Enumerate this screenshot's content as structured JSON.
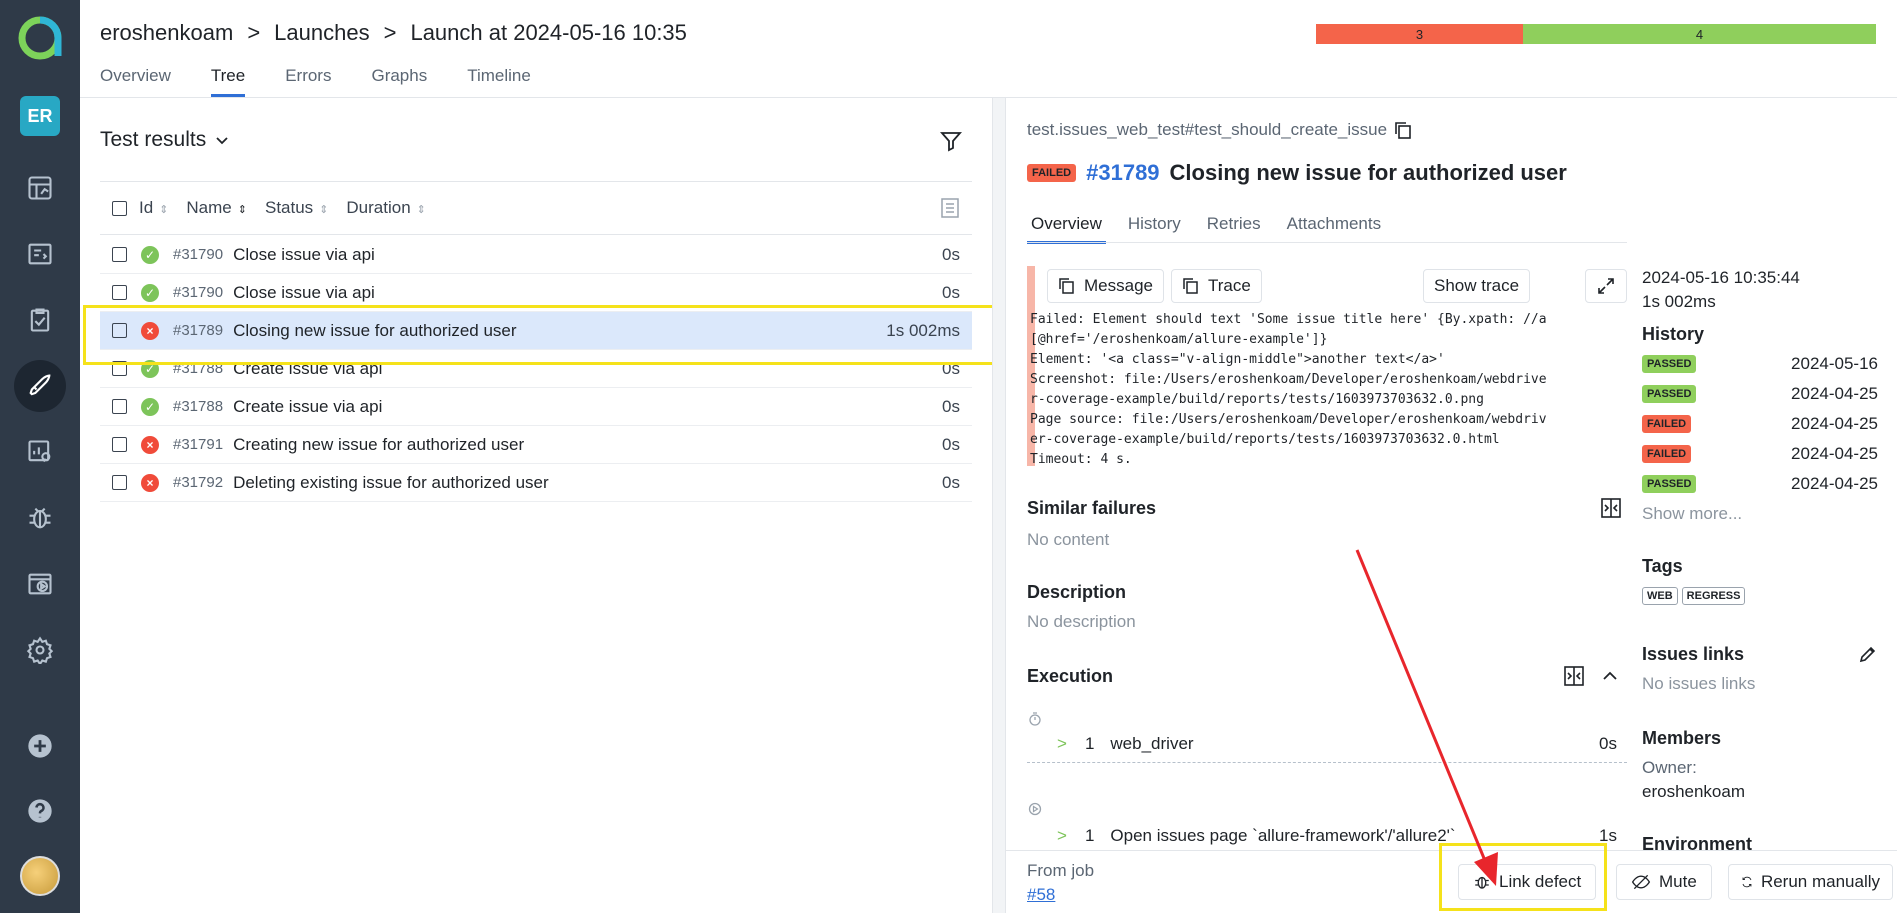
{
  "sidebar": {
    "avatar_initials": "ER",
    "items": [
      "dashboards-icon",
      "test-cases-icon",
      "test-plans-icon",
      "launches-icon",
      "analytics-icon",
      "defects-icon",
      "jobs-icon",
      "settings-icon"
    ]
  },
  "header": {
    "breadcrumb": [
      "eroshenkoam",
      "Launches",
      "Launch at 2024-05-16 10:35"
    ],
    "tabs": [
      "Overview",
      "Tree",
      "Errors",
      "Graphs",
      "Timeline"
    ],
    "active_tab": "Tree",
    "stats": {
      "failed": "3",
      "passed": "4"
    }
  },
  "colors": {
    "failed": "#f4644a",
    "passed": "#8fcf5c",
    "accent": "#2f6fd6",
    "sidebar": "#2f3a48"
  },
  "tree": {
    "title": "Test results",
    "columns": [
      "Id",
      "Name",
      "Status",
      "Duration"
    ],
    "rows": [
      {
        "id": "#31790",
        "name": "Close issue via api",
        "status": "passed",
        "duration": "0s"
      },
      {
        "id": "#31790",
        "name": "Close issue via api",
        "status": "passed",
        "duration": "0s"
      },
      {
        "id": "#31789",
        "name": "Closing new issue for authorized user",
        "status": "failed",
        "duration": "1s 002ms"
      },
      {
        "id": "#31788",
        "name": "Create issue via api",
        "status": "passed",
        "duration": "0s"
      },
      {
        "id": "#31788",
        "name": "Create issue via api",
        "status": "passed",
        "duration": "0s"
      },
      {
        "id": "#31791",
        "name": "Creating new issue for authorized user",
        "status": "failed",
        "duration": "0s"
      },
      {
        "id": "#31792",
        "name": "Deleting existing issue for authorized user",
        "status": "failed",
        "duration": "0s"
      }
    ]
  },
  "detail": {
    "path": "test.issues_web_test#test_should_create_issue",
    "status": "FAILED",
    "id": "#31789",
    "title": "Closing new issue for authorized user",
    "tabs": [
      "Overview",
      "History",
      "Retries",
      "Attachments"
    ],
    "message_btn": "Message",
    "trace_btn": "Trace",
    "show_trace_btn": "Show trace",
    "message_lines": [
      "Failed: Element should text 'Some issue title here' {By.xpath: //a",
      "[@href='/eroshenkoam/allure-example']}",
      "Element: '<a class=\"v-align-middle\">another text</a>'",
      "Screenshot: file:/Users/eroshenkoam/Developer/eroshenkoam/webdrive",
      "r-coverage-example/build/reports/tests/1603973703632.0.png",
      "Page source: file:/Users/eroshenkoam/Developer/eroshenkoam/webdriv",
      "er-coverage-example/build/reports/tests/1603973703632.0.html",
      "Timeout: 4 s."
    ],
    "similar_failures": "Similar failures",
    "similar_empty": "No content",
    "description": "Description",
    "description_empty": "No description",
    "execution": "Execution",
    "steps": [
      {
        "num": "1",
        "name": "web_driver",
        "duration": "0s"
      },
      {
        "num": "1",
        "name": "Open issues page `allure-framework'/'allure2'`",
        "duration": "1s"
      }
    ],
    "from_job": "From job",
    "job_link": "#58",
    "link_defect": "Link defect",
    "mute": "Mute",
    "rerun": "Rerun manually"
  },
  "meta": {
    "started": "2024-05-16 10:35:44",
    "duration": "1s 002ms",
    "history_title": "History",
    "history": [
      {
        "status": "PASSED",
        "date": "2024-05-16"
      },
      {
        "status": "PASSED",
        "date": "2024-04-25"
      },
      {
        "status": "FAILED",
        "date": "2024-04-25"
      },
      {
        "status": "FAILED",
        "date": "2024-04-25"
      },
      {
        "status": "PASSED",
        "date": "2024-04-25"
      }
    ],
    "show_more": "Show more...",
    "tags_title": "Tags",
    "tags": [
      "WEB",
      "REGRESS"
    ],
    "issues_title": "Issues links",
    "issues_empty": "No issues links",
    "members_title": "Members",
    "owner_label": "Owner:",
    "owner": "eroshenkoam",
    "environment_title": "Environment"
  }
}
